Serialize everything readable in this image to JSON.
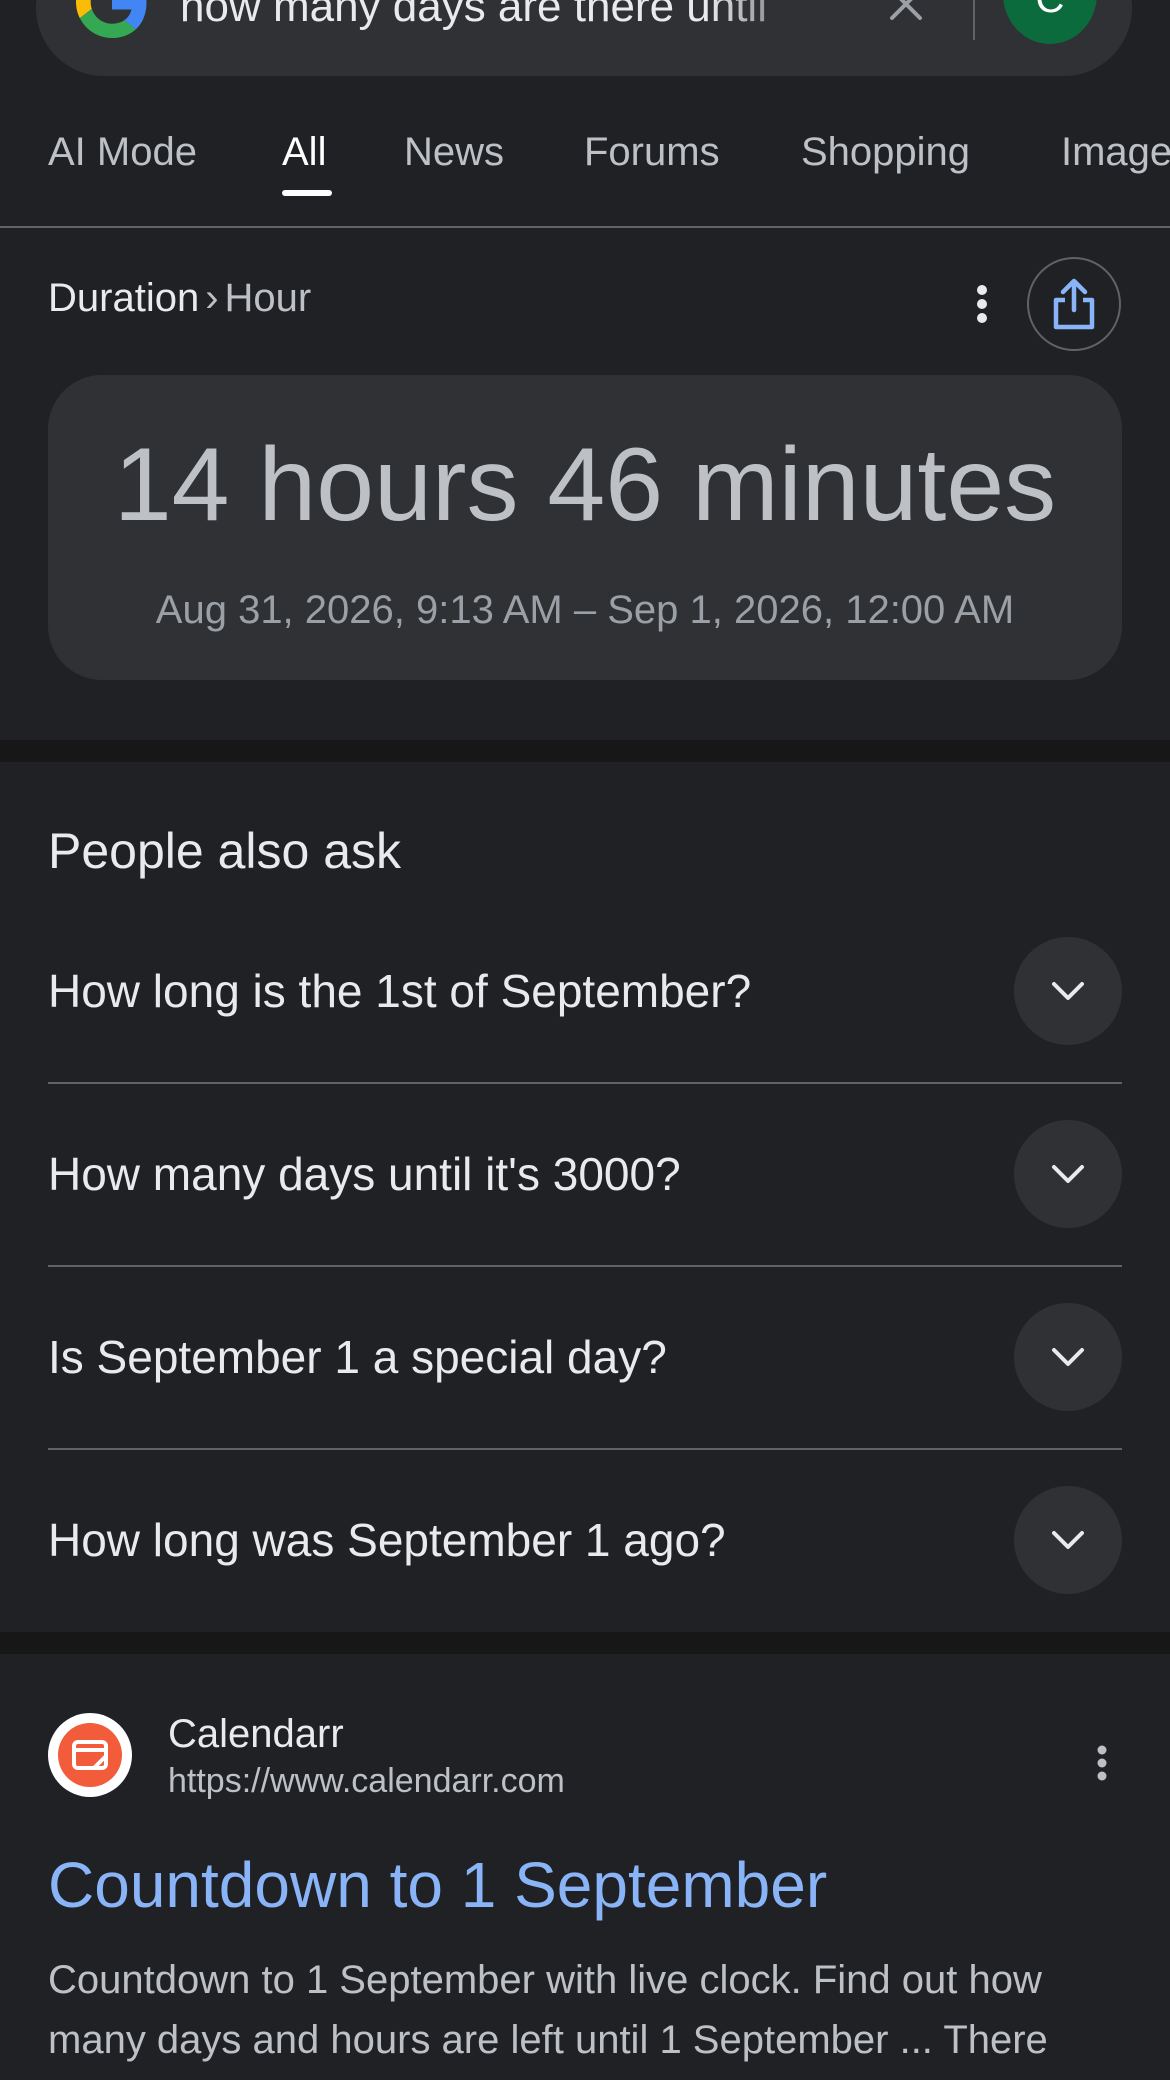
{
  "search": {
    "query": "how many days are there until",
    "avatar_initial": "C"
  },
  "tabs": [
    {
      "label": "AI Mode",
      "active": false
    },
    {
      "label": "All",
      "active": true
    },
    {
      "label": "News",
      "active": false
    },
    {
      "label": "Forums",
      "active": false
    },
    {
      "label": "Shopping",
      "active": false
    },
    {
      "label": "Image",
      "active": false
    }
  ],
  "converter": {
    "category": "Duration",
    "separator": "›",
    "unit": "Hour",
    "value": "14 hours 46 minutes",
    "range": "Aug 31, 2026, 9:13 AM – Sep 1, 2026, 12:00 AM"
  },
  "people_also_ask": {
    "heading": "People also ask",
    "questions": [
      "How long is the 1st of September?",
      "How many days until it's 3000?",
      "Is September 1 a special day?",
      "How long was September 1 ago?"
    ]
  },
  "result": {
    "site_name": "Calendarr",
    "url": "https://www.calendarr.com",
    "title": "Countdown to 1 September",
    "snippet": "Countdown to 1 September with live clock. Find out how many days and hours are left until 1 September ... There"
  },
  "colors": {
    "background": "#202124",
    "surface": "#303134",
    "link": "#8ab4f8",
    "avatar": "#0b6b3c",
    "favicon_accent": "#f25c3b"
  }
}
